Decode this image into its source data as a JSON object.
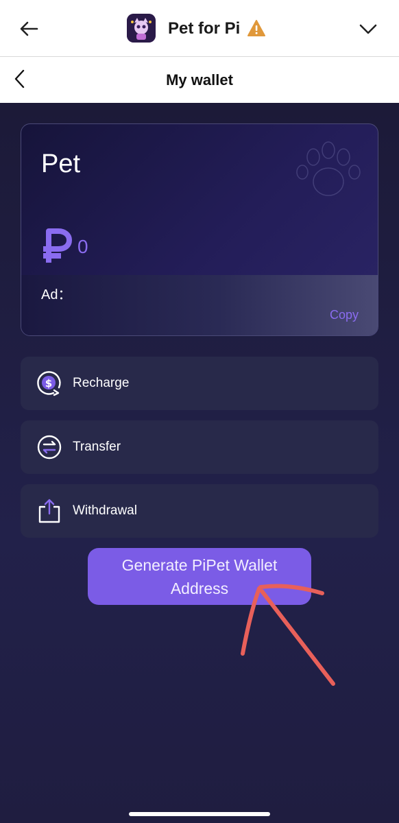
{
  "topbar": {
    "app_title": "Pet for Pi",
    "back_icon": "arrow-left-icon",
    "warning_icon": "warning-icon",
    "menu_icon": "chevron-down-icon"
  },
  "navbar": {
    "title": "My wallet",
    "back_icon": "chevron-left-icon"
  },
  "wallet": {
    "name": "Pet",
    "currency_symbol": "₽",
    "balance": "0",
    "address_label": "Ad：",
    "copy_label": "Copy"
  },
  "actions": [
    {
      "label": "Recharge",
      "icon": "recharge-dollar-icon"
    },
    {
      "label": "Transfer",
      "icon": "transfer-icon"
    },
    {
      "label": "Withdrawal",
      "icon": "withdrawal-icon"
    }
  ],
  "generate_button": {
    "label": "Generate PiPet Wallet Address"
  },
  "colors": {
    "accent": "#7b5ce6",
    "background": "#1f1d3d",
    "annotation": "#e8605a"
  }
}
